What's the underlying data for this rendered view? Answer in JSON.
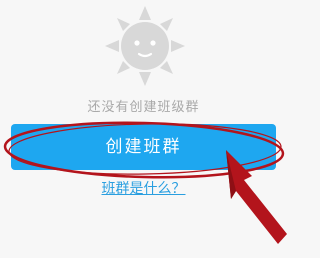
{
  "empty_state": {
    "icon": "empty-class-sun-face-icon",
    "message": "还没有创建班级群"
  },
  "primary_action": {
    "label": "创建班群"
  },
  "help": {
    "link_text": "班群是什么？"
  },
  "colors": {
    "background": "#f7f7f7",
    "button": "#1ea7f0",
    "link": "#2a9fe0",
    "muted_text": "#a9a9a9",
    "annotation": "#b3141c"
  }
}
